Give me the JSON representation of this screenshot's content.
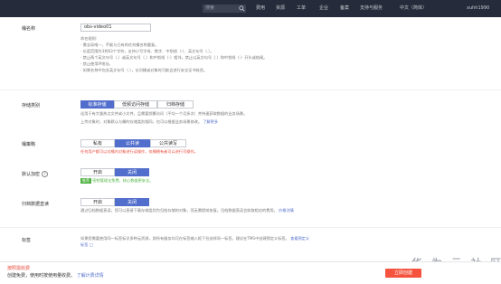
{
  "topbar": {
    "search_placeholder": "搜索",
    "nav": [
      "费用",
      "资源",
      "工单",
      "企业",
      "备案",
      "支持与服务",
      "中文（简体）",
      "xuhh1990"
    ]
  },
  "bucket_name": {
    "label": "桶名称",
    "value": "obs-video01",
    "rules_title": "命名规则：",
    "rules": [
      "· 需全局唯一，不能与已有的任何桶名称重复。",
      "· 长度范围为3到63个字符，支持小写字母、数字、中划线（-）、英文句号（.）。",
      "· 禁止两个英文句号（.）或英文句号（.）和中划线（-）相邻，禁止以英文句号（.）和中划线（-）开头或结尾。",
      "· 禁止使用IP地址。",
      "· 如果名称中包含英文句号（.），访问桶或对象时可能会进行安全证书校验。"
    ]
  },
  "storage_class": {
    "label": "存储类别",
    "options": [
      "标准存储",
      "低频访问存储",
      "归档存储"
    ],
    "selected": "标准存储",
    "desc1": "适用于有大量热点文件或小文件，且需要频繁访问（平均一个月多次）并快速获取数据的业务场景。",
    "desc2": "上传对象时，对象默认与桶的存储类别相同，也可以根据业务场景修改。",
    "desc2_link": "了解更多"
  },
  "bucket_policy": {
    "label": "桶策略",
    "options": [
      "私有",
      "公共读",
      "公共读写"
    ],
    "selected": "公共读",
    "warning": "任何用户都可以对桶内对象进行读操作，仅桶拥有者可以进行写操作。"
  },
  "default_encryption": {
    "label": "默认加密",
    "options": [
      "开启",
      "关闭"
    ],
    "selected": "关闭",
    "tag": "推荐",
    "tag_text": "密钥管理全免费，核心数据更安全。"
  },
  "archive_direct_read": {
    "label": "归档数据直读",
    "options": [
      "开启",
      "关闭"
    ],
    "selected": "关闭",
    "desc": "通过归档数据直读，您可以直接下载存储类别为归档存储的对象，而无需提前恢复。归档数据直读会收取相应的费用。",
    "desc_link": "价格详情"
  },
  "tags": {
    "label": "标签",
    "desc": "如果您需要使用同一标签标识多种云资源，即所有服务均可在标签输入框下拉选择同一标签，建议在TMS中创建预定义标签。",
    "link1": "查看预定义",
    "link2": "标签"
  },
  "bottom": {
    "price_label": "按照需收费",
    "price_desc": "创建免费，使用时按使用量收费。",
    "price_link": "了解计费详情",
    "create_button": "立即创建"
  },
  "watermark": "华 为 云 社 区",
  "colors": {
    "topbar": "#252b3a",
    "accent": "#526ecc",
    "danger": "#e84c3d",
    "create_button": "#f5533d"
  }
}
